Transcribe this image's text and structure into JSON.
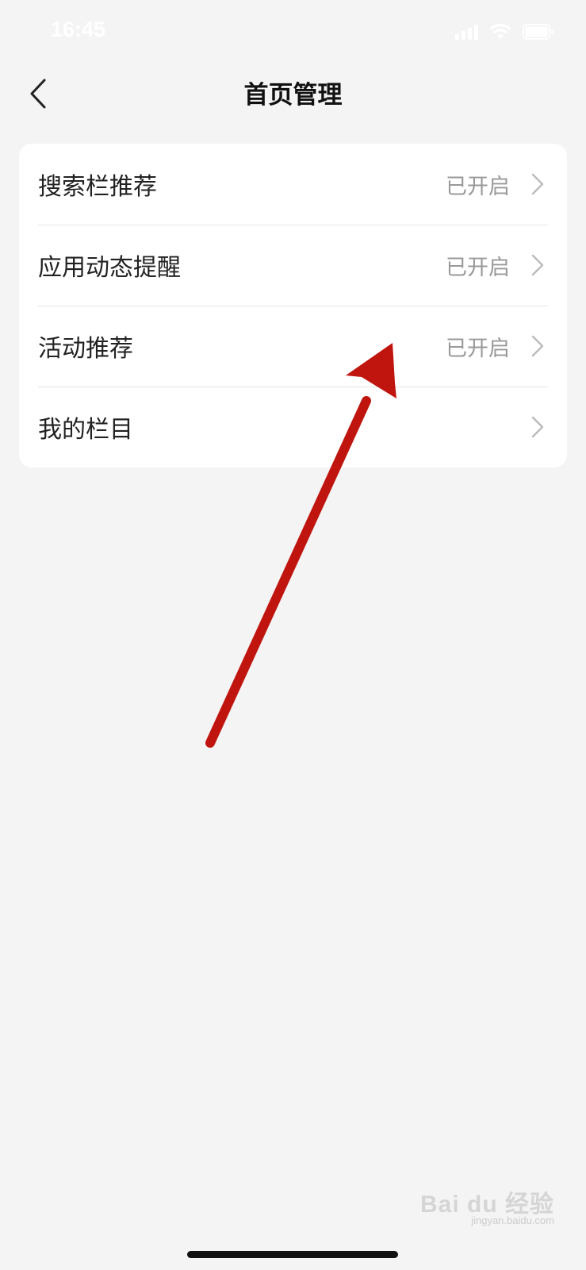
{
  "status_bar": {
    "time": "16:45",
    "icons": [
      "signal-icon",
      "wifi-icon",
      "battery-icon"
    ]
  },
  "nav": {
    "title": "首页管理",
    "back_icon": "chevron-left-icon"
  },
  "settings": {
    "items": [
      {
        "label": "搜索栏推荐",
        "status": "已开启"
      },
      {
        "label": "应用动态提醒",
        "status": "已开启"
      },
      {
        "label": "活动推荐",
        "status": "已开启"
      },
      {
        "label": "我的栏目",
        "status": ""
      }
    ]
  },
  "annotation": {
    "arrow_color": "#c0150f"
  },
  "watermark": {
    "main": "Bai du 经验",
    "sub": "jingyan.baidu.com"
  },
  "colors": {
    "background": "#f4f4f4",
    "card": "#ffffff",
    "status_text": "#999999",
    "divider": "#e6e6e6"
  }
}
